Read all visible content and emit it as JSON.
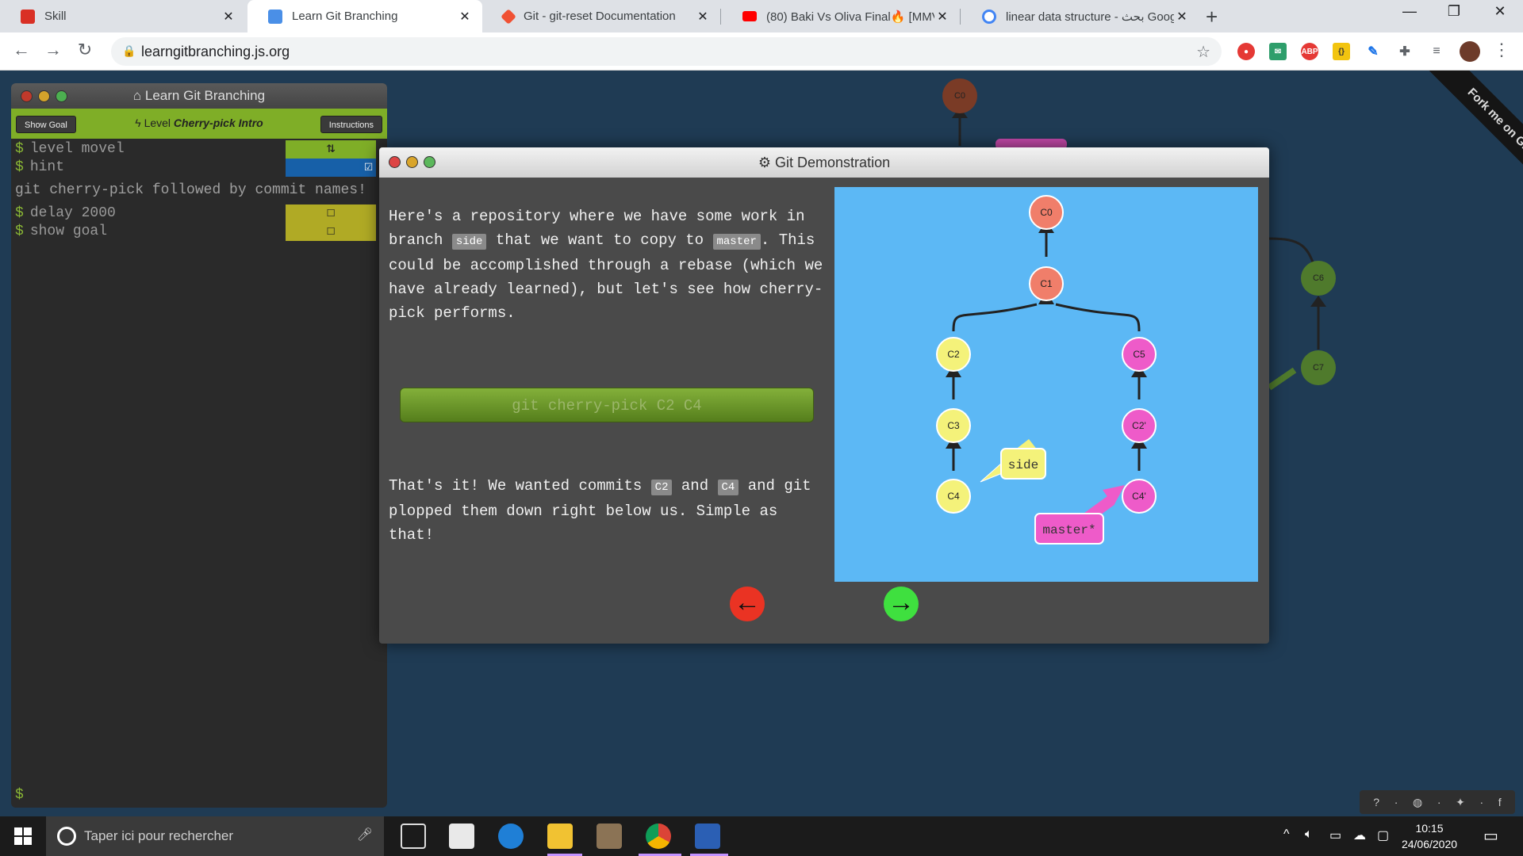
{
  "browser": {
    "tabs": [
      {
        "title": "Skill",
        "color": "#d93025"
      },
      {
        "title": "Learn Git Branching",
        "color": "#4a8fe7"
      },
      {
        "title": "Git - git-reset Documentation",
        "color": "#f05133"
      },
      {
        "title": "(80) Baki Vs Oliva Final🔥 [MMV]",
        "color": "#ff0000"
      },
      {
        "title": "linear data structure - بحث Googl",
        "color": "#4285f4"
      }
    ],
    "url": "learngitbranching.js.org"
  },
  "terminal": {
    "title": "Learn Git Branching",
    "show_goal": "Show Goal",
    "level_prefix": "Level",
    "level_name": "Cherry-pick Intro",
    "instructions": "Instructions",
    "lines": [
      {
        "cmd": "level movel"
      },
      {
        "cmd": "hint"
      }
    ],
    "hint_text": "git cherry-pick followed by commit names!",
    "lines2": [
      {
        "cmd": "delay 2000"
      },
      {
        "cmd": "show goal"
      }
    ],
    "prompt": "$"
  },
  "background_nodes": {
    "top": "C0",
    "right1": "C6",
    "right2": "C7"
  },
  "modal": {
    "title": "Git Demonstration",
    "p1_a": "Here's a repository where we have some work in branch",
    "p1_side": "side",
    "p1_b": "that we want to copy to",
    "p1_master": "master",
    "p1_c": ". This could be accomplished through a rebase (which we have already learned), but let's see how cherry-pick performs.",
    "command": "git cherry-pick C2 C4",
    "p2_a": "That's it! We wanted commits",
    "p2_c2": "C2",
    "p2_and": "and",
    "p2_c4": "C4",
    "p2_b": "and git plopped them down right below us. Simple as that!"
  },
  "graph": {
    "nodes": [
      "C0",
      "C1",
      "C2",
      "C3",
      "C4",
      "C5",
      "C2'",
      "C4'"
    ],
    "branch_side": "side",
    "branch_master": "master*"
  },
  "taskbar": {
    "search_placeholder": "Taper ici pour rechercher",
    "time": "10:15",
    "date": "24/06/2020"
  },
  "fork_ribbon": "Fork me on GitHub"
}
